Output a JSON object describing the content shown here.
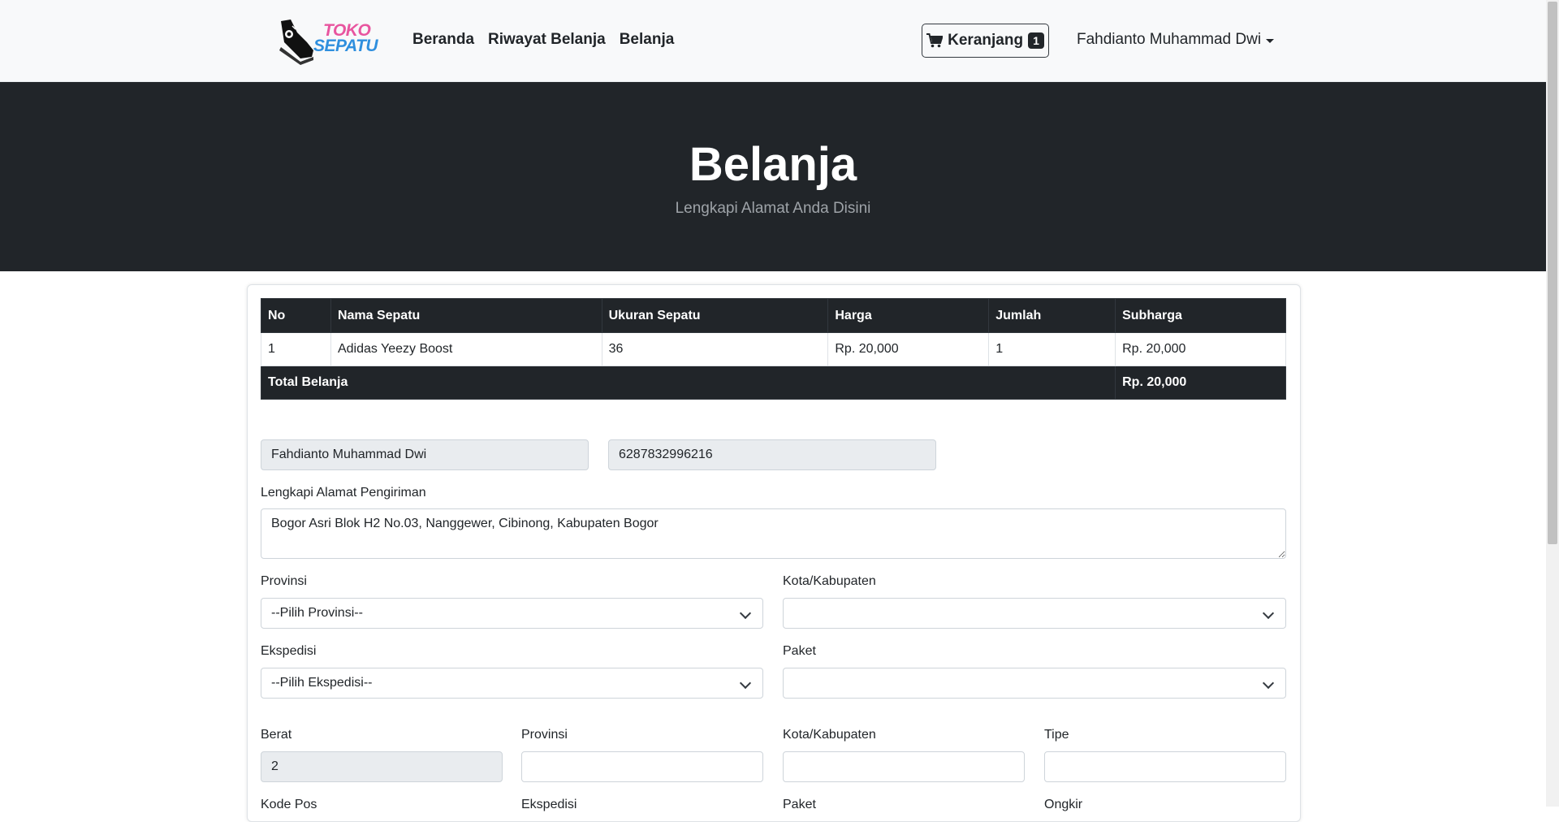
{
  "brand": {
    "line1": "TOKO",
    "line2": "SEPATU"
  },
  "nav": {
    "links": [
      "Beranda",
      "Riwayat Belanja",
      "Belanja"
    ]
  },
  "cart": {
    "label": "Keranjang",
    "count": "1"
  },
  "user": {
    "name": "Fahdianto Muhammad Dwi"
  },
  "hero": {
    "title": "Belanja",
    "subtitle": "Lengkapi Alamat Anda Disini"
  },
  "table": {
    "headers": [
      "No",
      "Nama Sepatu",
      "Ukuran Sepatu",
      "Harga",
      "Jumlah",
      "Subharga"
    ],
    "rows": [
      [
        "1",
        "Adidas Yeezy Boost",
        "36",
        "Rp. 20,000",
        "1",
        "Rp. 20,000"
      ]
    ],
    "total_label": "Total Belanja",
    "total_value": "Rp. 20,000"
  },
  "form": {
    "name": "Fahdianto Muhammad Dwi",
    "phone": "6287832996216",
    "address_label": "Lengkapi Alamat Pengiriman",
    "address": "Bogor Asri Blok H2 No.03, Nanggewer, Cibinong, Kabupaten Bogor",
    "provinsi_label": "Provinsi",
    "provinsi_value": "--Pilih Provinsi--",
    "kota_label": "Kota/Kabupaten",
    "kota_value": "",
    "ekspedisi_label": "Ekspedisi",
    "ekspedisi_value": "--Pilih Ekspedisi--",
    "paket_label": "Paket",
    "paket_value": "",
    "berat_label": "Berat",
    "berat_value": "2",
    "provinsi2_label": "Provinsi",
    "kota2_label": "Kota/Kabupaten",
    "tipe_label": "Tipe",
    "kodepos_label": "Kode Pos",
    "ekspedisi2_label": "Ekspedisi",
    "paket2_label": "Paket",
    "ongkir_label": "Ongkir"
  },
  "colors": {
    "dark": "#212529",
    "brand_pink": "#e8559f",
    "brand_blue": "#2f8fde",
    "readonly_bg": "#e9ecef"
  }
}
